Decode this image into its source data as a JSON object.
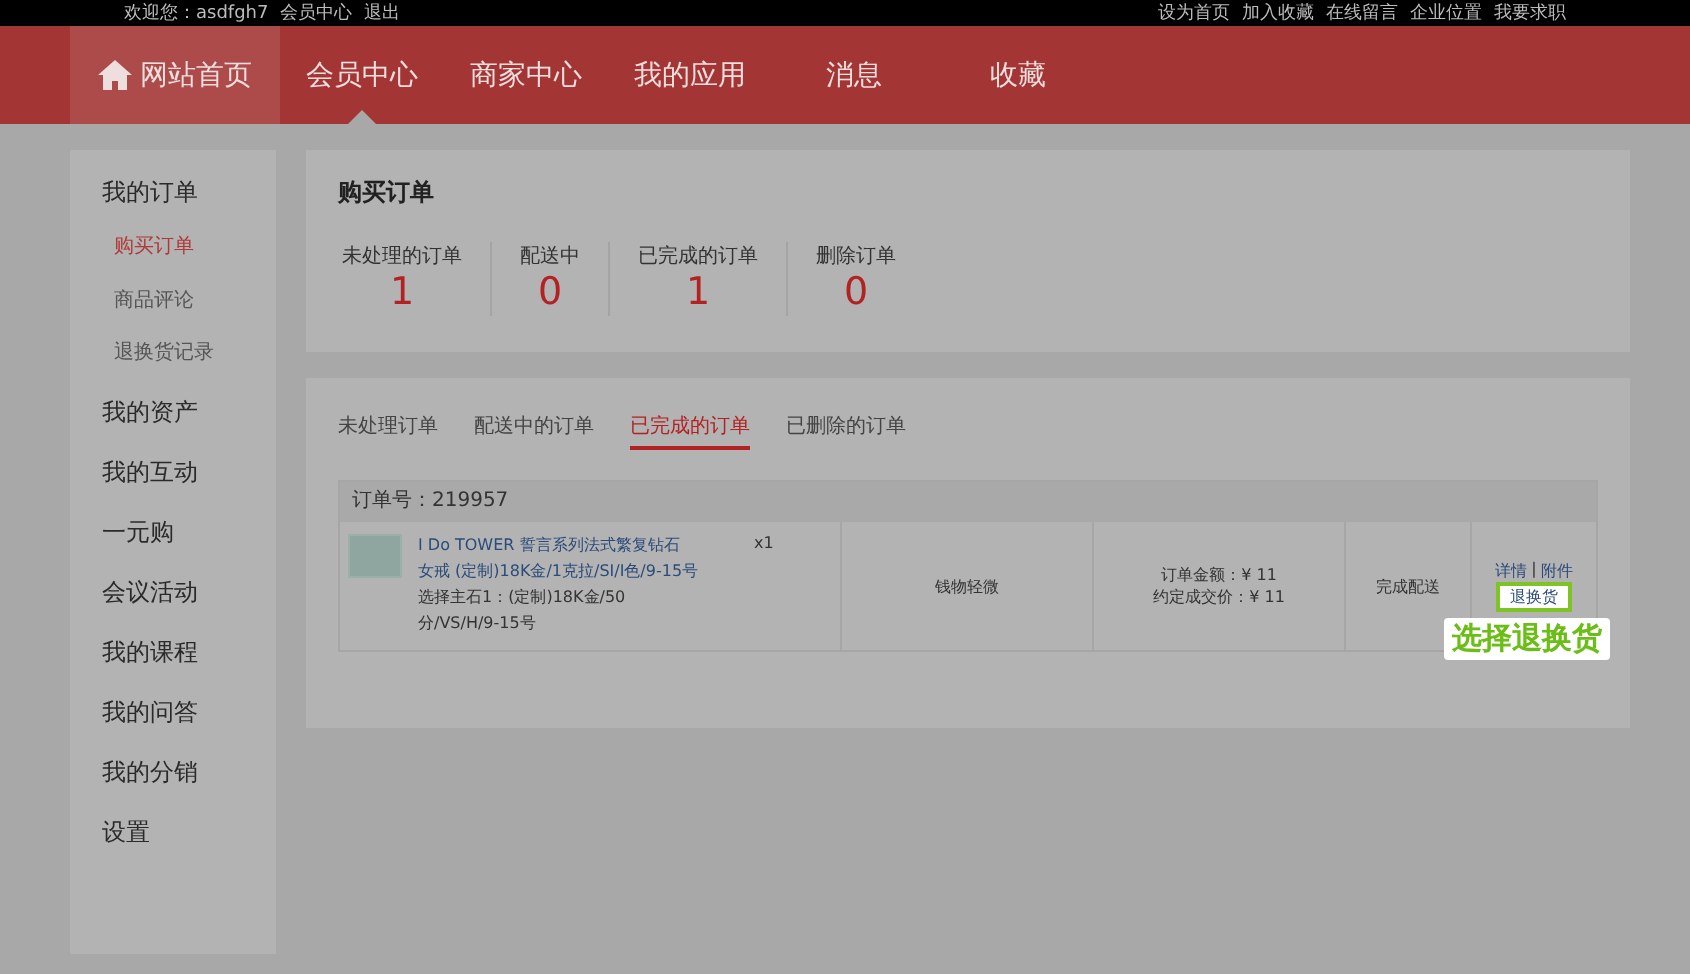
{
  "top_bar": {
    "left": [
      "欢迎您：asdfgh7",
      "会员中心",
      "退出"
    ],
    "right": [
      "设为首页",
      "加入收藏",
      "在线留言",
      "企业位置",
      "我要求职"
    ]
  },
  "nav": [
    {
      "label": "网站首页",
      "kind": "home",
      "selected": false
    },
    {
      "label": "会员中心",
      "kind": "link",
      "selected": true
    },
    {
      "label": "商家中心",
      "kind": "link",
      "selected": false
    },
    {
      "label": "我的应用",
      "kind": "link",
      "selected": false
    },
    {
      "label": "消息",
      "kind": "link",
      "selected": false
    },
    {
      "label": "收藏",
      "kind": "link",
      "selected": false
    }
  ],
  "sidebar": {
    "items": [
      {
        "label": "我的订单",
        "children": [
          {
            "label": "购买订单",
            "selected": true
          },
          {
            "label": "商品评论",
            "selected": false
          },
          {
            "label": "退换货记录",
            "selected": false
          }
        ]
      },
      {
        "label": "我的资产"
      },
      {
        "label": "我的互动"
      },
      {
        "label": "一元购"
      },
      {
        "label": "会议活动"
      },
      {
        "label": "我的课程"
      },
      {
        "label": "我的问答"
      },
      {
        "label": "我的分销"
      },
      {
        "label": "设置"
      }
    ]
  },
  "summary": {
    "title": "购买订单",
    "stats": [
      {
        "label": "未处理的订单",
        "value": "1"
      },
      {
        "label": "配送中",
        "value": "0"
      },
      {
        "label": "已完成的订单",
        "value": "1"
      },
      {
        "label": "删除订单",
        "value": "0"
      }
    ]
  },
  "tabs": [
    {
      "label": "未处理订单",
      "selected": false
    },
    {
      "label": "配送中的订单",
      "selected": false
    },
    {
      "label": "已完成的订单",
      "selected": true
    },
    {
      "label": "已删除的订单",
      "selected": false
    }
  ],
  "order": {
    "number": "订单号：219957",
    "product_lines": [
      "I Do TOWER 誓言系列法式繁复钻石",
      "女戒 (定制)18K金/1克拉/SI/I色/9-15号"
    ],
    "options_lines": [
      "选择主石1：(定制)18K金/50",
      "分/VS/H/9-15号"
    ],
    "quantity": "x1",
    "delivery": "钱物轻微",
    "amount": "订单金额：¥ 11",
    "deal_price": "约定成交价：¥ 11",
    "status": "完成配送",
    "links": [
      "详情",
      "附件"
    ],
    "link_separator": "|",
    "return_link": "退换货",
    "callout": "选择退换货"
  }
}
